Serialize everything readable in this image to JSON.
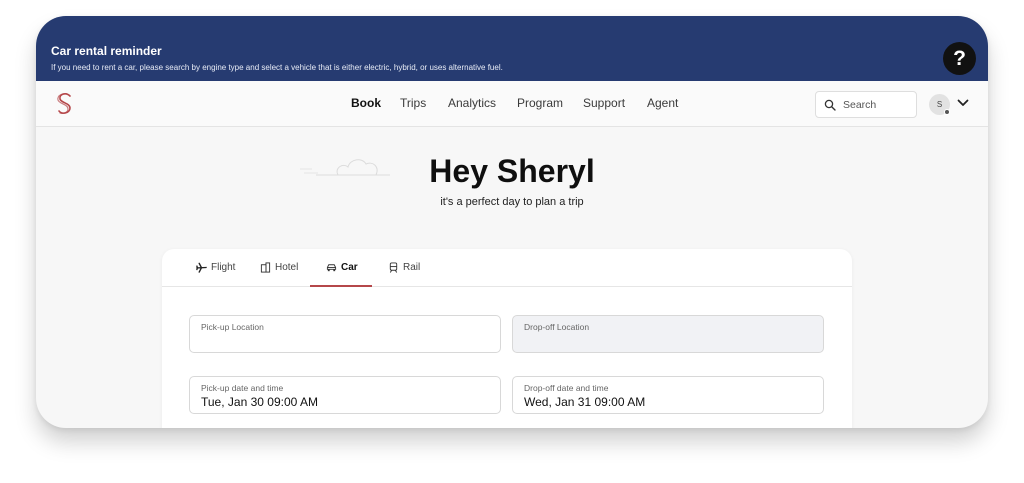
{
  "banner": {
    "title": "Car rental reminder",
    "text": "If you need to rent a car, please search by engine type and select a vehicle that is either electric, hybrid, or uses alternative fuel.",
    "help_label": "?",
    "bg_color": "#263b71"
  },
  "nav": {
    "logo_icon": "s-logo-icon",
    "items": [
      {
        "label": "Book",
        "active": true
      },
      {
        "label": "Trips",
        "active": false
      },
      {
        "label": "Analytics",
        "active": false
      },
      {
        "label": "Program",
        "active": false
      },
      {
        "label": "Support",
        "active": false
      },
      {
        "label": "Agent",
        "active": false
      }
    ],
    "search_placeholder": "Search",
    "avatar_initial": "S"
  },
  "hero": {
    "title": "Hey Sheryl",
    "subtitle": "it's a perfect day to plan a trip"
  },
  "booking": {
    "tabs": [
      {
        "label": "Flight",
        "icon": "plane-icon",
        "active": false
      },
      {
        "label": "Hotel",
        "icon": "building-icon",
        "active": false
      },
      {
        "label": "Car",
        "icon": "car-icon",
        "active": true
      },
      {
        "label": "Rail",
        "icon": "train-icon",
        "active": false
      }
    ],
    "accent_color": "#b5474a",
    "fields": {
      "pickup_location": {
        "label": "Pick-up Location",
        "value": ""
      },
      "dropoff_location": {
        "label": "Drop-off Location",
        "value": ""
      },
      "pickup_datetime": {
        "label": "Pick-up date and time",
        "value": "Tue, Jan 30 09:00 AM"
      },
      "dropoff_datetime": {
        "label": "Drop-off date and time",
        "value": "Wed, Jan 31 09:00 AM"
      }
    }
  }
}
